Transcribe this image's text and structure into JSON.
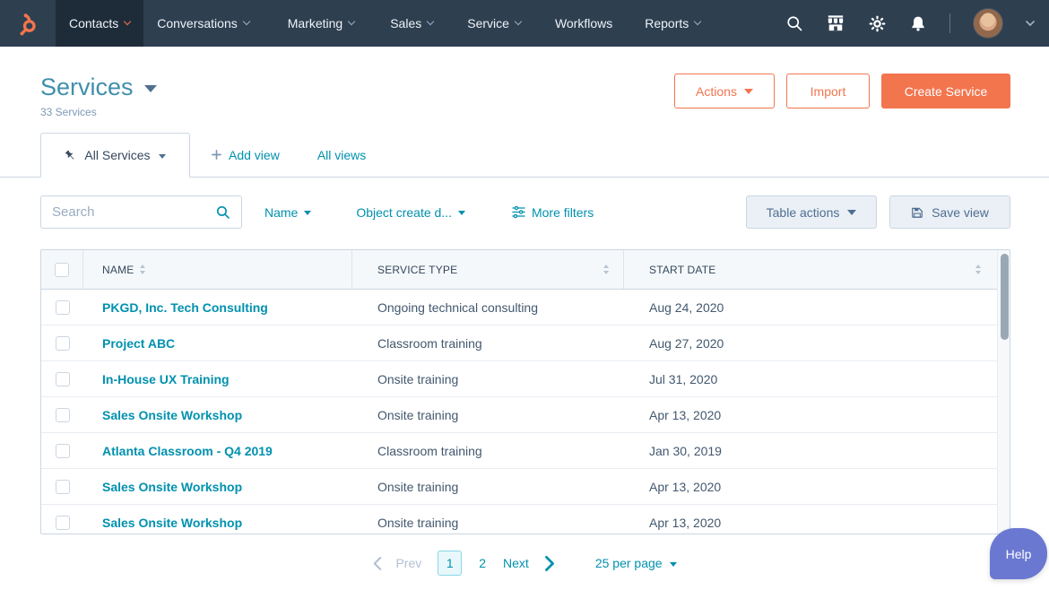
{
  "nav": {
    "items": [
      {
        "label": "Contacts",
        "active": true
      },
      {
        "label": "Conversations",
        "active": false
      },
      {
        "label": "Marketing",
        "active": false
      },
      {
        "label": "Sales",
        "active": false
      },
      {
        "label": "Service",
        "active": false
      },
      {
        "label": "Workflows",
        "active": false
      },
      {
        "label": "Reports",
        "active": false
      }
    ],
    "icons": [
      "search-icon",
      "marketplace-icon",
      "settings-icon",
      "notifications-icon"
    ]
  },
  "header": {
    "title": "Services",
    "subtitle": "33 Services",
    "actions_label": "Actions",
    "import_label": "Import",
    "create_label": "Create Service"
  },
  "views": {
    "active_tab": "All Services",
    "add_view": "Add view",
    "all_views": "All views"
  },
  "filters": {
    "search_placeholder": "Search",
    "name_filter": "Name",
    "date_filter": "Object create d...",
    "more_filters": "More filters",
    "table_actions": "Table actions",
    "save_view": "Save view"
  },
  "table": {
    "columns": [
      "NAME",
      "SERVICE TYPE",
      "START DATE"
    ],
    "rows": [
      {
        "name": "PKGD, Inc. Tech Consulting",
        "type": "Ongoing technical consulting",
        "date": "Aug 24, 2020"
      },
      {
        "name": "Project ABC",
        "type": "Classroom training",
        "date": "Aug 27, 2020"
      },
      {
        "name": "In-House UX Training",
        "type": "Onsite training",
        "date": "Jul 31, 2020"
      },
      {
        "name": "Sales Onsite Workshop",
        "type": "Onsite training",
        "date": "Apr 13, 2020"
      },
      {
        "name": "Atlanta Classroom - Q4 2019",
        "type": "Classroom training",
        "date": "Jan 30, 2019"
      },
      {
        "name": "Sales Onsite Workshop",
        "type": "Onsite training",
        "date": "Apr 13, 2020"
      },
      {
        "name": "Sales Onsite Workshop",
        "type": "Onsite training",
        "date": "Apr 13, 2020"
      }
    ]
  },
  "pagination": {
    "prev": "Prev",
    "pages": [
      "1",
      "2"
    ],
    "current_page": "1",
    "next": "Next",
    "per_page": "25 per page"
  },
  "help": {
    "label": "Help"
  },
  "colors": {
    "nav_bg": "#2e3f50",
    "nav_active_bg": "#1e2c3a",
    "coral": "#f2754e",
    "link_teal": "#0091ae",
    "title_teal": "#408fac",
    "dark_text": "#33475b",
    "muted_text": "#7c98b6",
    "border": "#cbd6e2",
    "table_header_bg": "#f5f8fa",
    "help_purple": "#6a78d1"
  }
}
